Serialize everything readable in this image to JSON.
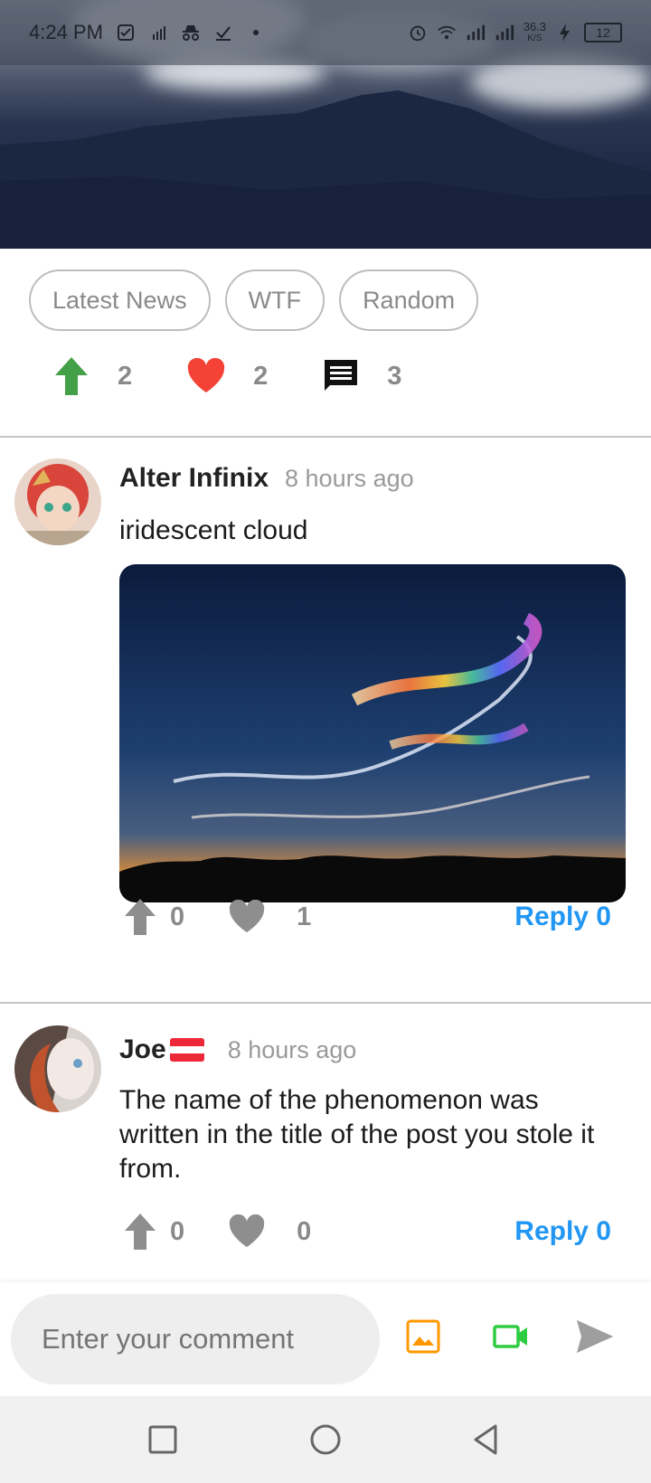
{
  "status_bar": {
    "time": "4:24 PM",
    "net_speed": "36.3",
    "net_unit": "K/S",
    "battery": "12"
  },
  "tags": [
    "Latest News",
    "WTF",
    "Random"
  ],
  "post_stats": {
    "upvotes": "2",
    "likes": "2",
    "comments": "3"
  },
  "comments": [
    {
      "author": "Alter Infinix",
      "time": "8 hours ago",
      "text": "iridescent cloud",
      "upvotes": "0",
      "likes": "1",
      "reply_label": "Reply 0"
    },
    {
      "author": "Joe",
      "time": "8 hours ago",
      "text": "The name of the phenomenon was written in the title of the post you stole it from.",
      "upvotes": "0",
      "likes": "0",
      "reply_label": "Reply 0"
    }
  ],
  "comment_input": {
    "placeholder": "Enter your comment"
  },
  "colors": {
    "upvote_green": "#43a047",
    "heart_red": "#f44336",
    "reply_blue": "#2196f3",
    "image_icon_orange": "#ff9800",
    "video_icon_green": "#2ecc40"
  }
}
